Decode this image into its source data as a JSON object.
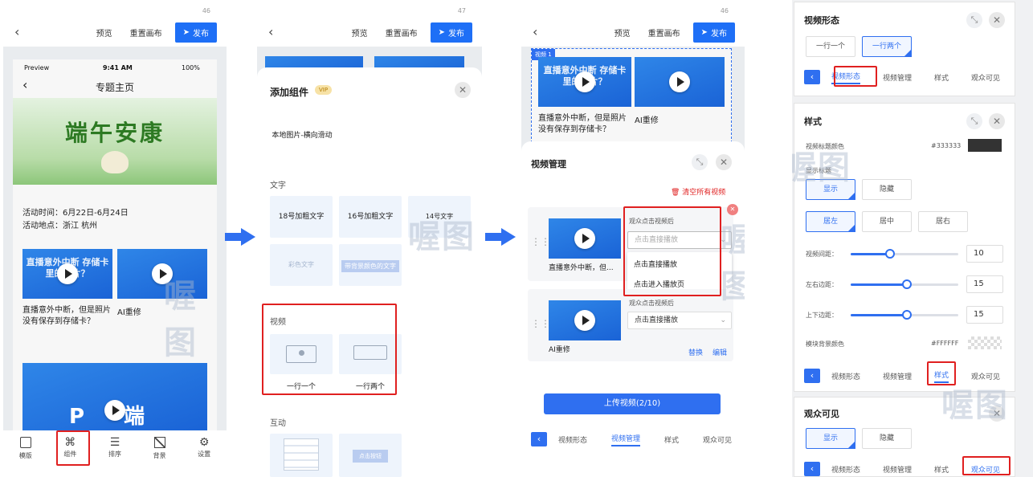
{
  "wm": "喔图",
  "p1": {
    "sbar_num": "46",
    "preview": "预览",
    "reset": "重置画布",
    "publish": "发布",
    "status_left": "Preview",
    "status_time": "9:41 AM",
    "status_right": "100%",
    "page_title": "专题主页",
    "banner": "端午安康",
    "time": "活动时间：6月22日-6月24日",
    "place": "活动地点：浙江 杭州",
    "video1_thumb": "直播意外中断 存储卡里的照片？",
    "video1": "直播意外中断，但是照片没有保存到存储卡？",
    "video2": "AI重修",
    "big_thumb": "P 端",
    "nav": [
      {
        "icon": "layout-icon",
        "label": "模版"
      },
      {
        "icon": "component-icon",
        "label": "组件"
      },
      {
        "icon": "sort-icon",
        "label": "排序"
      },
      {
        "icon": "background-icon",
        "label": "背景"
      },
      {
        "icon": "settings-icon",
        "label": "设置"
      }
    ]
  },
  "p2": {
    "sbar_num": "47",
    "preview": "预览",
    "reset": "重置画布",
    "publish": "发布",
    "title": "添加组件",
    "vip": "VIP",
    "img_item": "本地图片-横向滑动",
    "sec_text": "文字",
    "t1": "18号加粗文字",
    "t2": "16号加粗文字",
    "t3": "14号文字",
    "t4": "彩色文字",
    "t5": "带背景颜色的文字",
    "sec_video": "视频",
    "v1": "一行一个",
    "v2": "一行两个",
    "sec_interact": "互动",
    "btn_tile": "点击按钮"
  },
  "p3": {
    "sbar_num": "46",
    "preview": "预览",
    "reset": "重置画布",
    "publish": "发布",
    "video_tag": "视频 1",
    "v1_thumb": "直播意外中断 存储卡里的照片？",
    "v1_caption": "直播意外中断，但是照片没有保存到存储卡？",
    "v2_caption": "AI重修",
    "sheet_title": "视频管理",
    "clear_all": "清空所有视频",
    "row1_label": "观众点击视频后",
    "row1_placeholder": "点击直接播放",
    "row1_caption": "直播意外中断，但...",
    "opt1": "点击直接播放",
    "opt2": "点击进入播放页",
    "row2_label": "观众点击视频后",
    "row2_value": "点击直接播放",
    "row2_caption": "AI重修",
    "replace": "替换",
    "edit": "编辑",
    "upload": "上传视频(2/10)",
    "tabs": [
      "视频形态",
      "视频管理",
      "样式",
      "观众可见"
    ]
  },
  "p4": {
    "s1_title": "视频形态",
    "s1_opt1": "一行一个",
    "s1_opt2": "一行两个",
    "tabs": [
      "视频形态",
      "视频管理",
      "样式",
      "观众可见"
    ],
    "s2_title": "样式",
    "title_color_label": "视频标题颜色",
    "title_color": "#333333",
    "show_title_label": "显示标题",
    "show": "显示",
    "hide": "隐藏",
    "left": "居左",
    "center": "居中",
    "right": "居右",
    "gap_label": "视频间距：",
    "gap": "10",
    "lr_label": "左右边距：",
    "lr": "15",
    "tb_label": "上下边距：",
    "tb": "15",
    "bg_label": "模块背景颜色",
    "bg_color": "#FFFFFF",
    "s3_title": "观众可见",
    "s3_show": "显示",
    "s3_hide": "隐藏"
  }
}
